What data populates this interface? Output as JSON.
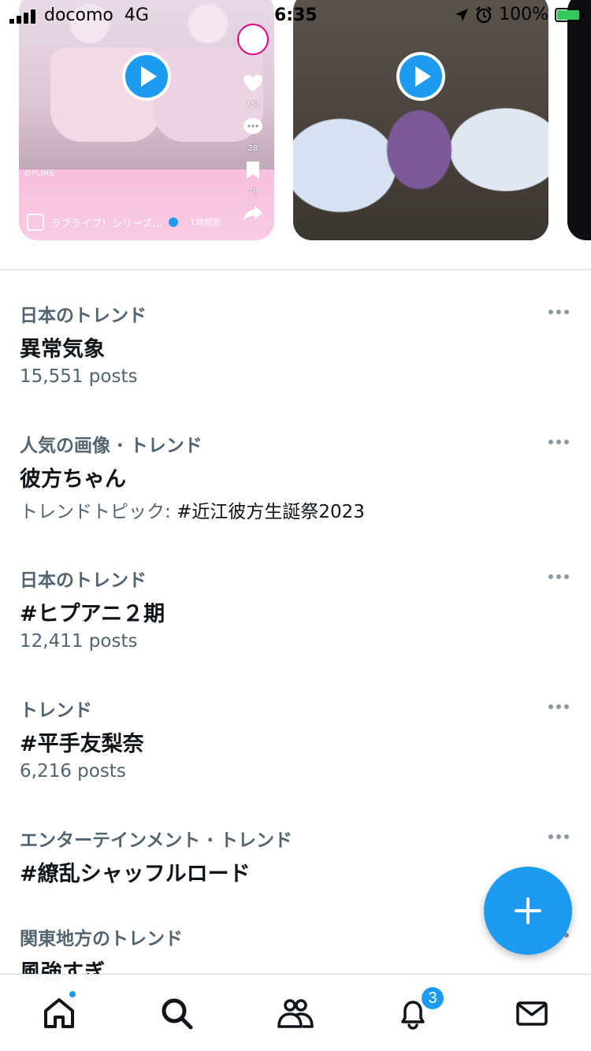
{
  "status_bar": {
    "carrier": "docomo",
    "network": "4G",
    "time": "6:35",
    "battery_percent": "100%"
  },
  "videos": [
    {
      "caption_account": "ラブライブ！シリーズ…",
      "caption_time": "· 1時間前",
      "watermark": "©PLIHS",
      "likes": "757",
      "comments": "28",
      "bookmarks": "78"
    },
    {}
  ],
  "trends": [
    {
      "context": "日本のトレンド",
      "name": "異常気象",
      "meta": "15,551 posts"
    },
    {
      "context": "人気の画像 · トレンド",
      "name": "彼方ちゃん",
      "meta_prefix": "トレンドトピック: ",
      "meta_hashtag": "#近江彼方生誕祭2023"
    },
    {
      "context": "日本のトレンド",
      "name": "#ヒプアニ２期",
      "meta": "12,411 posts"
    },
    {
      "context": "トレンド",
      "name": "#平手友梨奈",
      "meta": "6,216 posts"
    },
    {
      "context": "エンターテインメント · トレンド",
      "name": "#繚乱シャッフルロード"
    },
    {
      "context": "関東地方のトレンド",
      "name": "風強すぎ"
    }
  ],
  "tab_bar": {
    "notifications_badge": "3"
  },
  "colors": {
    "accent": "#1d9bf0",
    "secondary_text": "#536471",
    "primary_text": "#0f1419"
  }
}
